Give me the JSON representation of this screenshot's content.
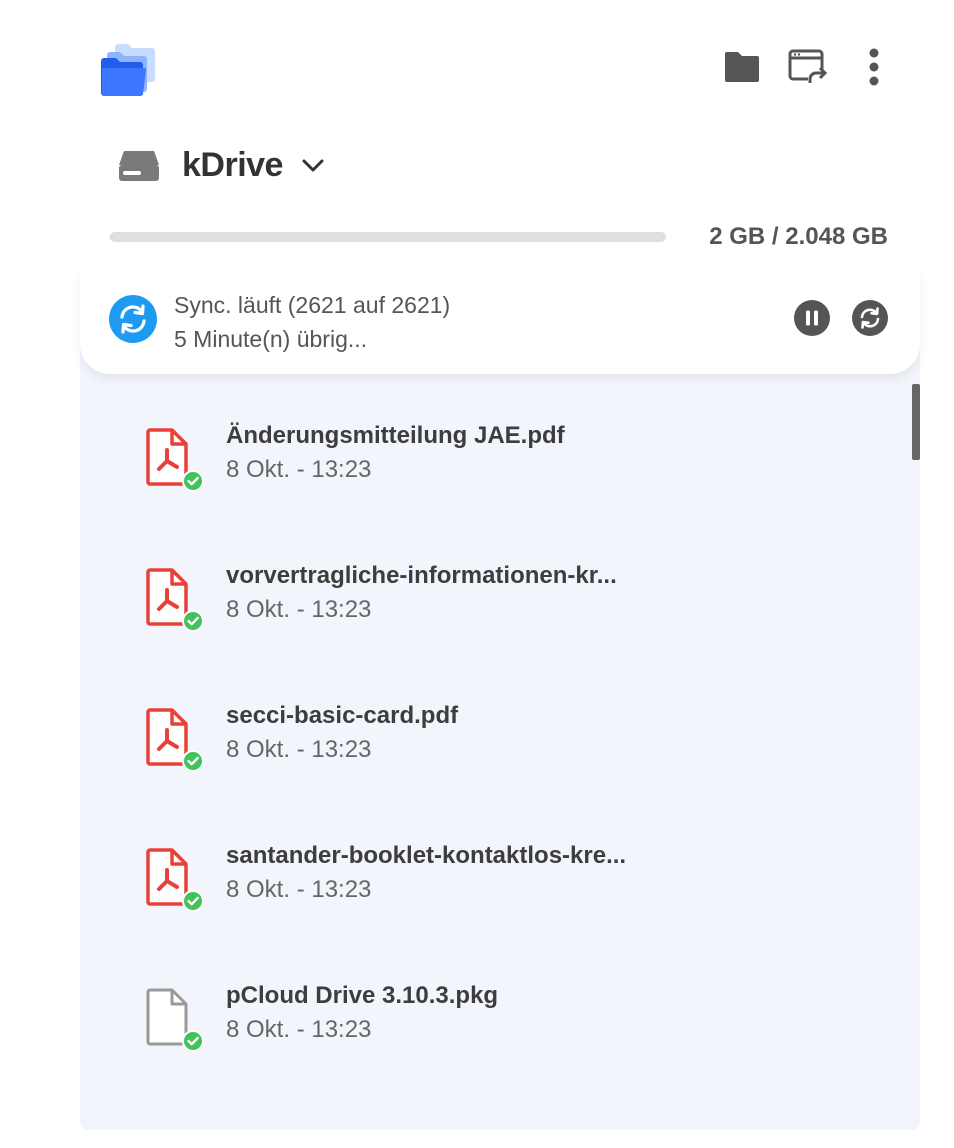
{
  "header": {
    "logo_icon": "kdrive-folder-logo-icon",
    "actions": [
      {
        "icon": "folder-icon"
      },
      {
        "icon": "open-web-icon"
      },
      {
        "icon": "more-vertical-icon"
      }
    ]
  },
  "drive": {
    "name": "kDrive",
    "icon": "hard-drive-icon",
    "dropdown_icon": "chevron-down-icon"
  },
  "quota": {
    "text": "2 GB / 2.048 GB",
    "used_fraction": 0.001
  },
  "sync": {
    "status_line": "Sync. läuft (2621 auf 2621)",
    "time_line": "5 Minute(n) übrig...",
    "accent_color": "#1e9bf0"
  },
  "files": [
    {
      "name": "Änderungsmitteilung JAE.pdf",
      "date": "8 Okt. - 13:23",
      "type": "pdf"
    },
    {
      "name": "vorvertragliche-informationen-kr...",
      "date": "8 Okt. - 13:23",
      "type": "pdf"
    },
    {
      "name": "secci-basic-card.pdf",
      "date": "8 Okt. - 13:23",
      "type": "pdf"
    },
    {
      "name": "santander-booklet-kontaktlos-kre...",
      "date": "8 Okt. - 13:23",
      "type": "pdf"
    },
    {
      "name": "pCloud Drive 3.10.3.pkg",
      "date": "8 Okt. - 13:23",
      "type": "generic"
    }
  ],
  "colors": {
    "pdf_red": "#e8413a",
    "synced_green": "#3fc35a",
    "panel_bg": "#f2f5fb"
  }
}
